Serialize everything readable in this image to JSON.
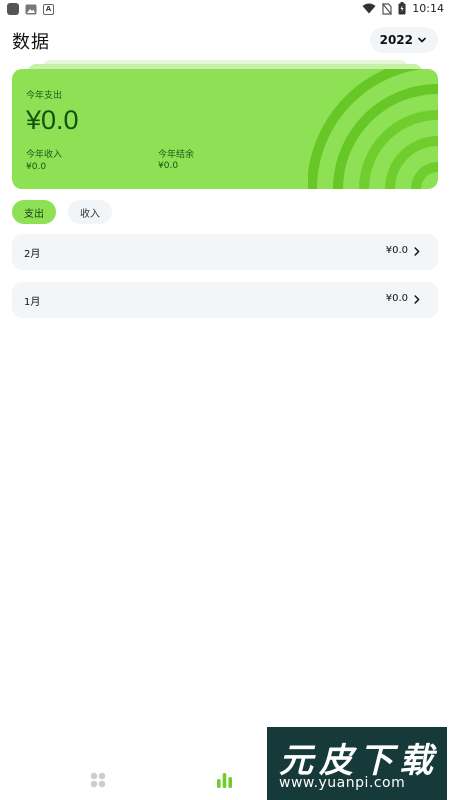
{
  "status_bar": {
    "time": "10:14",
    "icons": [
      "app-icon",
      "image-icon",
      "font-icon",
      "wifi-icon",
      "no-sim-icon",
      "battery-icon"
    ]
  },
  "header": {
    "title": "数据",
    "year": "2022"
  },
  "summary": {
    "expense_label": "今年支出",
    "expense_value": "¥0.0",
    "income_label": "今年收入",
    "income_value": "¥0.0",
    "balance_label": "今年结余",
    "balance_value": "¥0.0"
  },
  "toggle": {
    "expense": "支出",
    "income": "收入",
    "selected": "支出"
  },
  "months": [
    {
      "month": "2月",
      "amount": "¥0.0"
    },
    {
      "month": "1月",
      "amount": "¥0.0"
    }
  ],
  "bottom_nav": {
    "tabs": [
      "grid-icon",
      "bar-chart-icon"
    ],
    "active": "bar-chart-icon"
  },
  "watermark": {
    "logo": "元皮下载",
    "url": "www.yuanpi.com"
  },
  "colors": {
    "accent": "#8ee154",
    "accent_dark": "#14530f",
    "row_bg": "#f2f6f9",
    "watermark_bg": "#163a3a"
  }
}
